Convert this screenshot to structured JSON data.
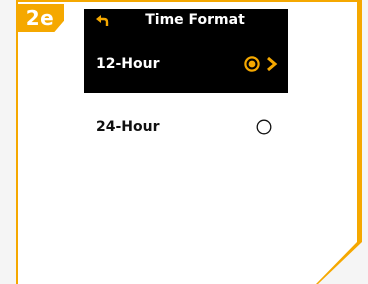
{
  "step": {
    "label": "2e"
  },
  "screen": {
    "title": "Time Format",
    "options": [
      {
        "label": "12-Hour",
        "selected": true
      },
      {
        "label": "24-Hour",
        "selected": false
      }
    ]
  },
  "colors": {
    "accent": "#f5a800",
    "screen_bg": "#000000",
    "screen_text": "#ffffff",
    "page_bg": "#ffffff"
  },
  "icons": {
    "back": "back-arrow-icon",
    "selected": "radio-selected-icon",
    "unselected": "radio-unselected-icon",
    "next": "chevron-right-icon"
  }
}
